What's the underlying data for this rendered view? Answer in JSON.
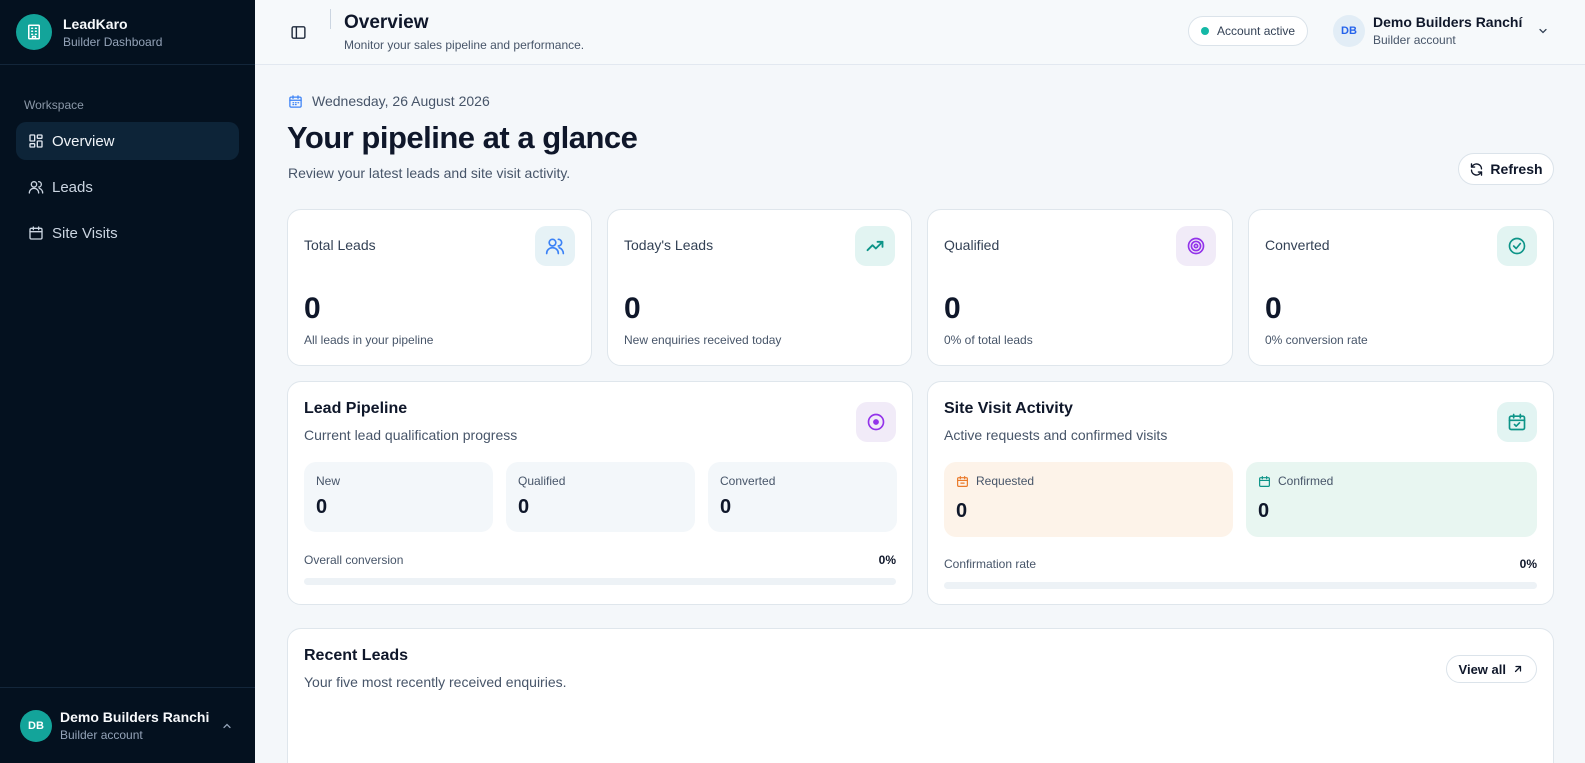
{
  "sidebar": {
    "brand_name": "LeadKaro",
    "brand_sub": "Builder Dashboard",
    "section_label": "Workspace",
    "items": [
      {
        "label": "Overview",
        "icon": "grid-icon",
        "active": true
      },
      {
        "label": "Leads",
        "icon": "users-icon",
        "active": false
      },
      {
        "label": "Site Visits",
        "icon": "calendar-icon",
        "active": false
      }
    ],
    "user": {
      "initials": "DB",
      "name": "Demo Builders Ranchi",
      "role": "Builder account"
    }
  },
  "header": {
    "title": "Overview",
    "subtitle": "Monitor your sales pipeline and performance.",
    "status": "Account active",
    "user": {
      "initials": "DB",
      "name": "Demo Builders Ranchí",
      "role": "Builder account"
    }
  },
  "main": {
    "date": "Wednesday, 26 August 2026",
    "title": "Your pipeline at a glance",
    "subtitle": "Review your latest leads and site visit activity.",
    "refresh_label": "Refresh",
    "stats": [
      {
        "label": "Total Leads",
        "value": "0",
        "desc": "All leads in your pipeline",
        "icon": "users-icon",
        "color": "#3b82f6"
      },
      {
        "label": "Today's Leads",
        "value": "0",
        "desc": "New enquiries received today",
        "icon": "trending-up-icon",
        "color": "#0d9488"
      },
      {
        "label": "Qualified",
        "value": "0",
        "desc": "0% of total leads",
        "icon": "target-icon",
        "color": "#9333ea"
      },
      {
        "label": "Converted",
        "value": "0",
        "desc": "0% conversion rate",
        "icon": "check-circle-icon",
        "color": "#0d9488"
      }
    ],
    "pipeline": {
      "title": "Lead Pipeline",
      "subtitle": "Current lead qualification progress",
      "stages": [
        {
          "label": "New",
          "value": "0"
        },
        {
          "label": "Qualified",
          "value": "0"
        },
        {
          "label": "Converted",
          "value": "0"
        }
      ],
      "rate_label": "Overall conversion",
      "rate_value": "0%",
      "rate": 0
    },
    "visits": {
      "title": "Site Visit Activity",
      "subtitle": "Active requests and confirmed visits",
      "requested_label": "Requested",
      "requested_value": "0",
      "confirmed_label": "Confirmed",
      "confirmed_value": "0",
      "rate_label": "Confirmation rate",
      "rate_value": "0%",
      "rate": 0
    },
    "recent": {
      "title": "Recent Leads",
      "subtitle": "Your five most recently received enquiries.",
      "view_all": "View all"
    }
  }
}
